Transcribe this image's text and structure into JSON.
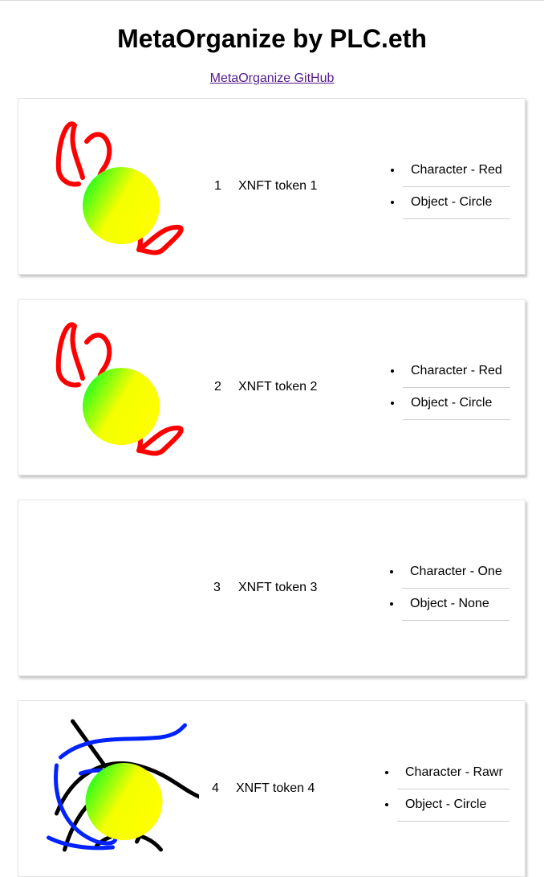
{
  "header": {
    "title": "MetaOrganize by PLC.eth",
    "link_label": "MetaOrganize GitHub"
  },
  "cards": [
    {
      "index": "1",
      "name": "XNFT token 1",
      "art": "red-scribble-gradient-circle",
      "attributes": [
        "Character - Red",
        "Object - Circle"
      ]
    },
    {
      "index": "2",
      "name": "XNFT token 2",
      "art": "red-scribble-gradient-circle",
      "attributes": [
        "Character - Red",
        "Object - Circle"
      ]
    },
    {
      "index": "3",
      "name": "XNFT token 3",
      "art": "none",
      "attributes": [
        "Character - One",
        "Object - None"
      ]
    },
    {
      "index": "4",
      "name": "XNFT token 4",
      "art": "black-blue-scribble-gradient-circle",
      "attributes": [
        "Character - Rawr",
        "Object - Circle"
      ]
    }
  ],
  "colors": {
    "link": "#551a8b",
    "circle_gradient_start": "#00ff22",
    "circle_gradient_end": "#ffff00",
    "scribble_red": "#ff0000",
    "scribble_blue": "#0022ff",
    "scribble_black": "#000000"
  }
}
